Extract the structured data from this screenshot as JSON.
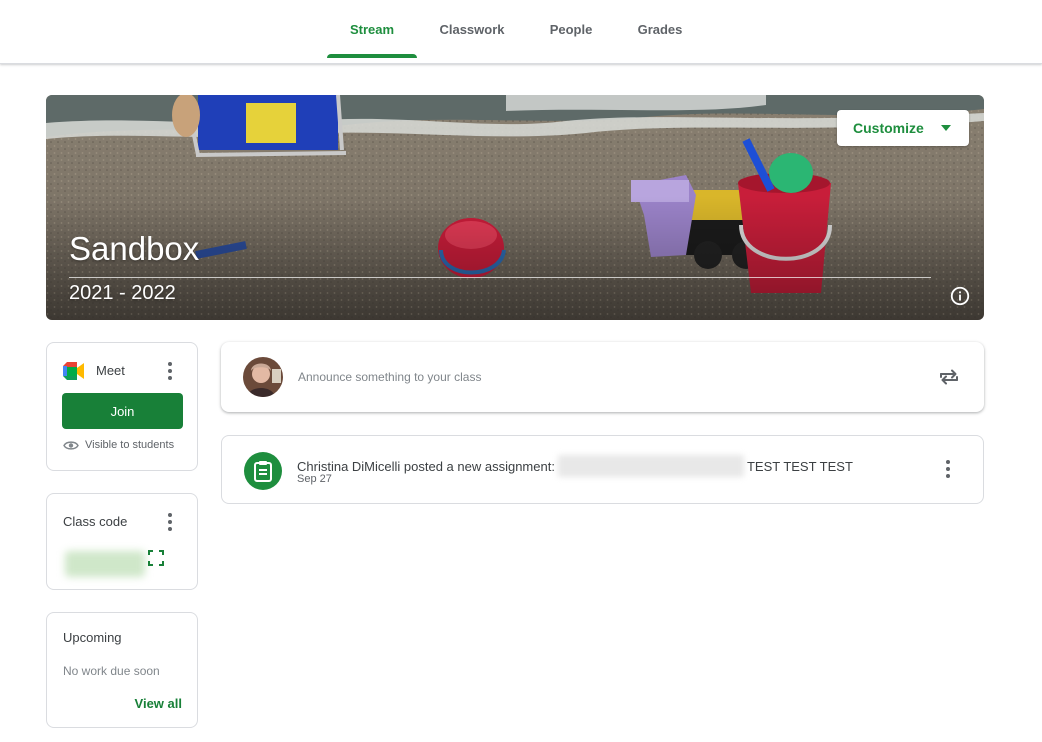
{
  "nav": {
    "tabs": [
      {
        "label": "Stream",
        "active": true
      },
      {
        "label": "Classwork",
        "active": false
      },
      {
        "label": "People",
        "active": false
      },
      {
        "label": "Grades",
        "active": false
      }
    ]
  },
  "banner": {
    "title": "Sandbox",
    "subtitle": "2021 - 2022",
    "customize_label": "Customize"
  },
  "meet": {
    "label": "Meet",
    "join_label": "Join",
    "visibility": "Visible to students"
  },
  "class_code": {
    "heading": "Class code"
  },
  "upcoming": {
    "heading": "Upcoming",
    "empty_text": "No work due soon",
    "view_all_label": "View all"
  },
  "announce": {
    "placeholder": "Announce something to your class"
  },
  "post": {
    "author_text": "Christina DiMicelli posted a new assignment:",
    "title_suffix": "TEST TEST TEST",
    "date": "Sep 27"
  },
  "colors": {
    "accent": "#1e8e3e",
    "join_button": "#188038"
  }
}
